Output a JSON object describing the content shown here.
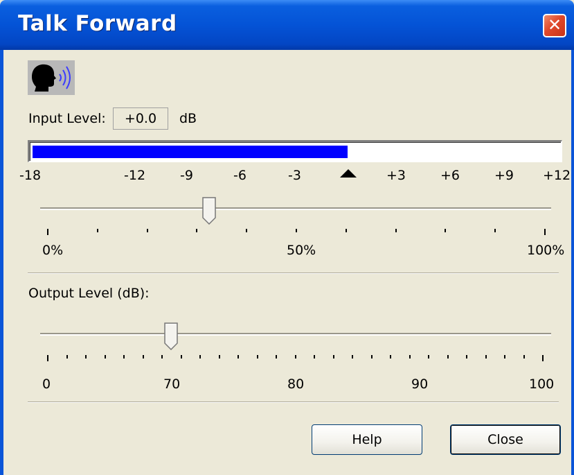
{
  "window": {
    "title": "Talk Forward",
    "close_glyph": "✕"
  },
  "input": {
    "label": "Input Level:",
    "value": "+0.0",
    "unit": "dB",
    "meter_level_fraction": 0.6,
    "meter_color": "#0000ff",
    "scale_labels": [
      "-18",
      "-12",
      "-9",
      "-6",
      "-3",
      "+3",
      "+6",
      "+9",
      "+12"
    ],
    "marker_icon": "triangle-up-icon",
    "slider_value_fraction": 0.33,
    "slider_labels": [
      "0%",
      "50%",
      "100%"
    ]
  },
  "output": {
    "label": "Output Level (dB):",
    "slider_value": 70,
    "slider_labels": [
      "0",
      "70",
      "80",
      "90",
      "100"
    ]
  },
  "buttons": {
    "help": "Help",
    "close": "Close"
  },
  "icons": {
    "speaker": "speaking-head-icon"
  }
}
